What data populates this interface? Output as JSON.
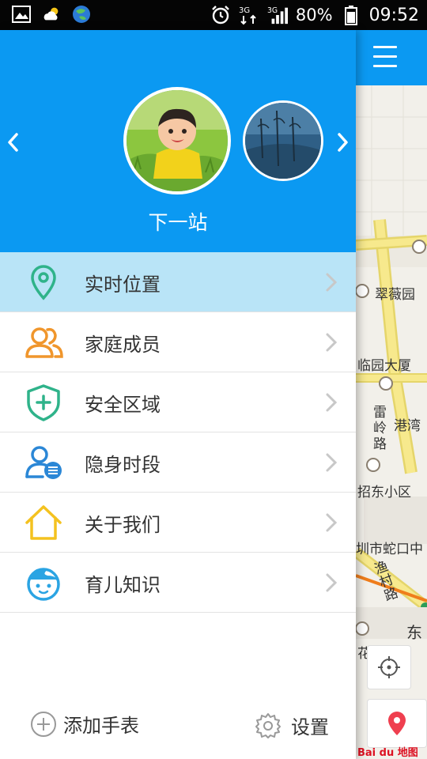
{
  "status_bar": {
    "battery": "80%",
    "time": "09:52",
    "network": "3G",
    "icons": [
      "image-icon",
      "weather-icon",
      "globe-icon",
      "alarm-icon",
      "signal-3g-icon",
      "signal-bars-icon",
      "battery-icon"
    ]
  },
  "drawer": {
    "device_name": "下一站",
    "menu": [
      {
        "label": "实时位置",
        "icon": "location-pin-icon",
        "color": "#2fb38a",
        "active": true
      },
      {
        "label": "家庭成员",
        "icon": "family-members-icon",
        "color": "#f0962c",
        "active": false
      },
      {
        "label": "安全区域",
        "icon": "shield-plus-icon",
        "color": "#2fb38a",
        "active": false
      },
      {
        "label": "隐身时段",
        "icon": "user-list-icon",
        "color": "#2b87d6",
        "active": false
      },
      {
        "label": "关于我们",
        "icon": "house-icon",
        "color": "#f4c21f",
        "active": false
      },
      {
        "label": "育儿知识",
        "icon": "baby-face-icon",
        "color": "#2ba4e3",
        "active": false
      }
    ],
    "footer": {
      "add_watch_label": "添加手表",
      "settings_label": "设置"
    },
    "colors": {
      "header": "#0b99f2",
      "active_row": "#b9e4f7"
    }
  },
  "map": {
    "labels": [
      "翠薇园",
      "临园大厦",
      "雷岭路",
      "港湾",
      "招东小区",
      "圳市蛇口中",
      "渔村路",
      "东",
      "花"
    ],
    "logo_text": "Bai du 地图"
  }
}
